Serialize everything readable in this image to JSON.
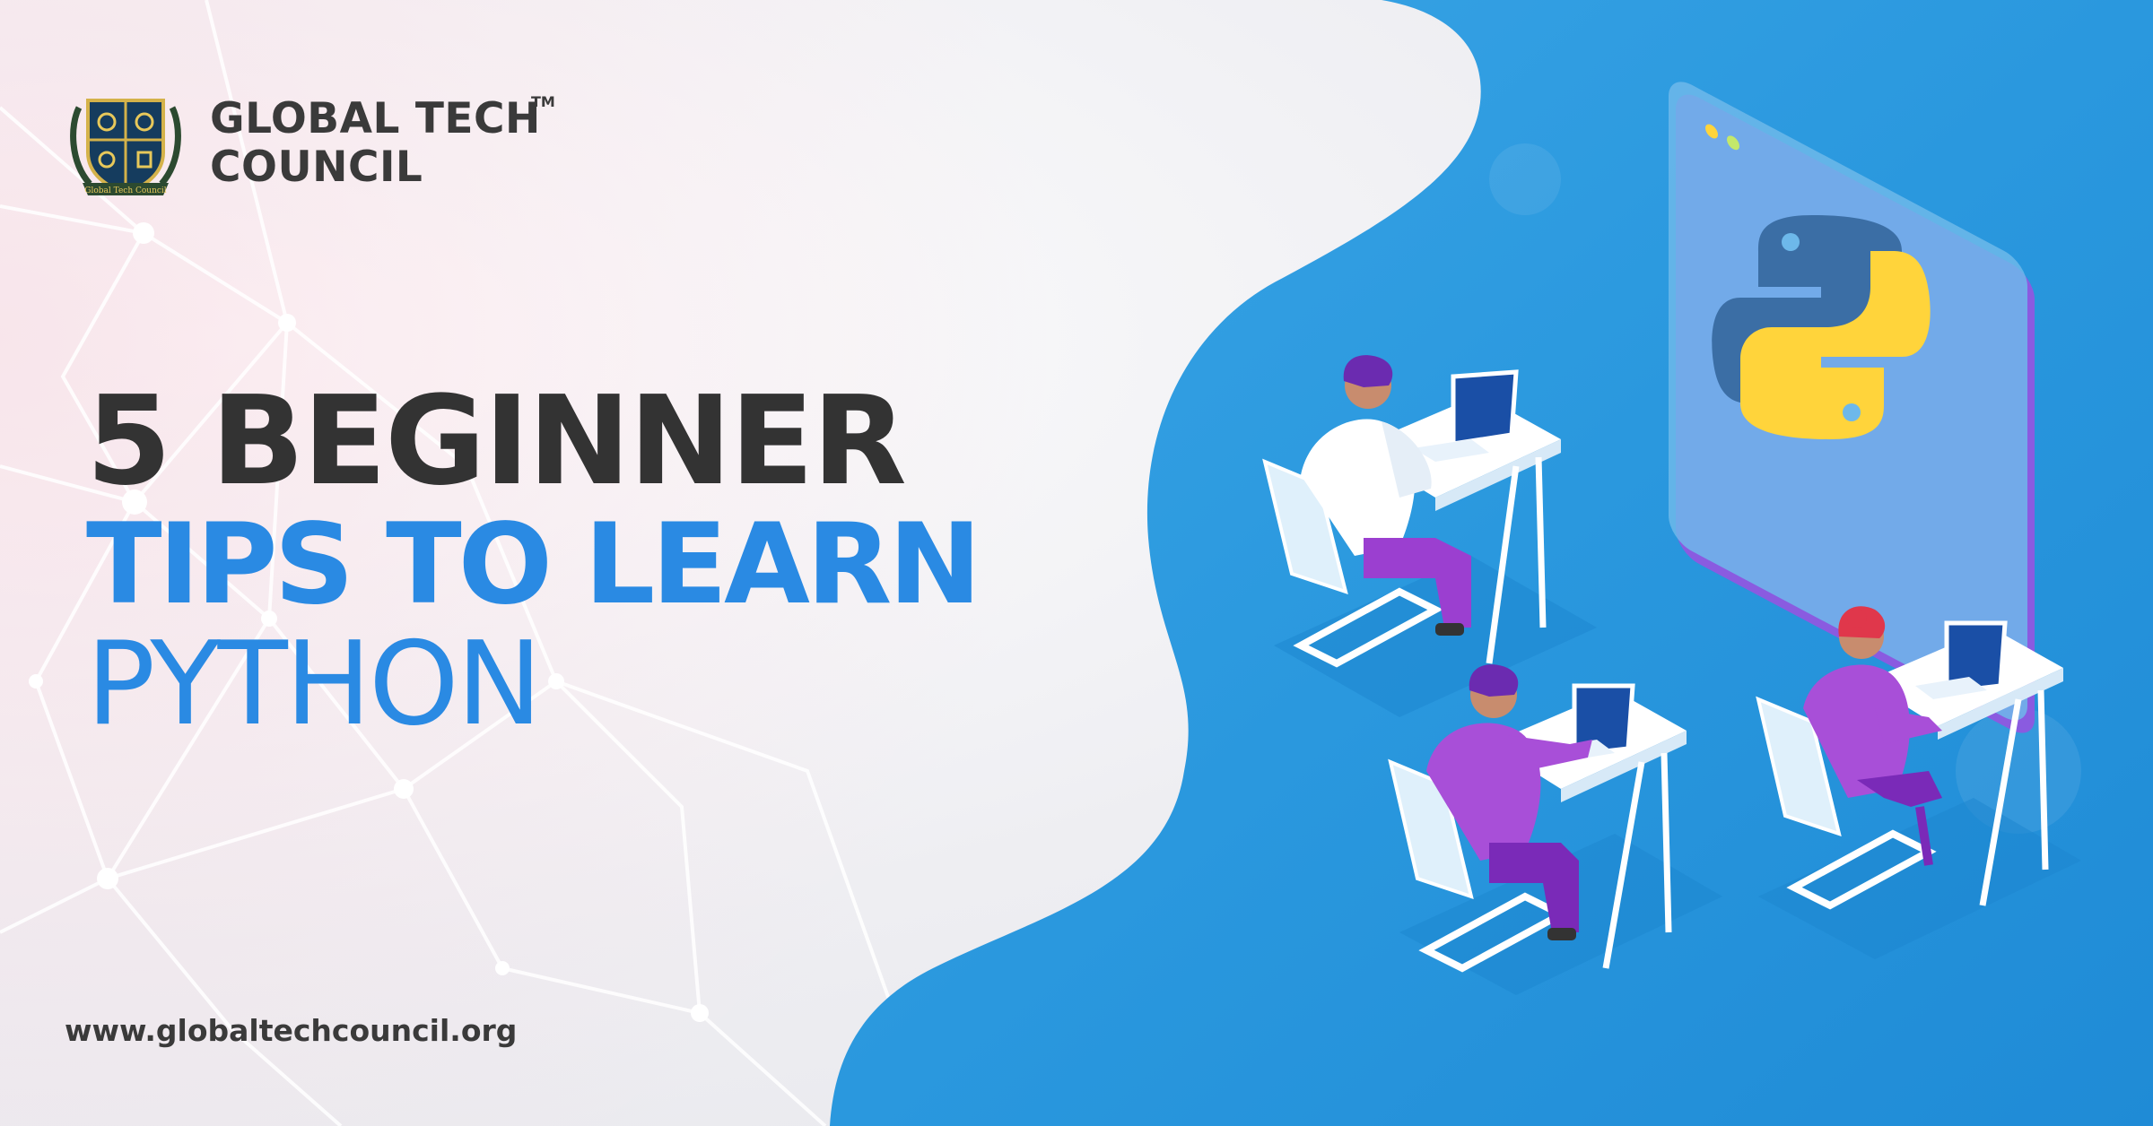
{
  "brand": {
    "name_line1": "GLOBAL TECH",
    "name_line2": "COUNCIL",
    "trademark": "TM",
    "emblem_icon": "shield-crest-icon",
    "emblem_ribbon_text": "Global Tech Council"
  },
  "headline": {
    "line1": "5 BEGINNER",
    "line2": "TIPS TO LEARN",
    "line3": "PYTHON"
  },
  "website": "www.globaltechcouncil.org",
  "illustration": {
    "icon": "python-logo-icon",
    "people": [
      "developer-white-shirt",
      "developer-purple-shirt",
      "developer-woman-purple"
    ]
  },
  "colors": {
    "dark_text": "#333333",
    "accent_blue": "#2a8ae3",
    "panel_blue": "#2b9be0",
    "python_blue": "#3b6ea5",
    "python_yellow": "#ffd43b",
    "purple": "#9b3fd0"
  }
}
